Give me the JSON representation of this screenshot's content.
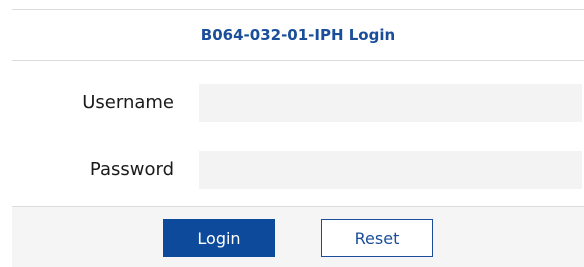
{
  "login": {
    "title": "B064-032-01-IPH Login",
    "username_label": "Username",
    "username_value": "",
    "password_label": "Password",
    "password_value": "",
    "login_button": "Login",
    "reset_button": "Reset"
  },
  "colors": {
    "accent": "#0d4a9b",
    "title": "#1a4e9a",
    "input_bg": "#f3f3f3",
    "border": "#dcdcdc"
  }
}
